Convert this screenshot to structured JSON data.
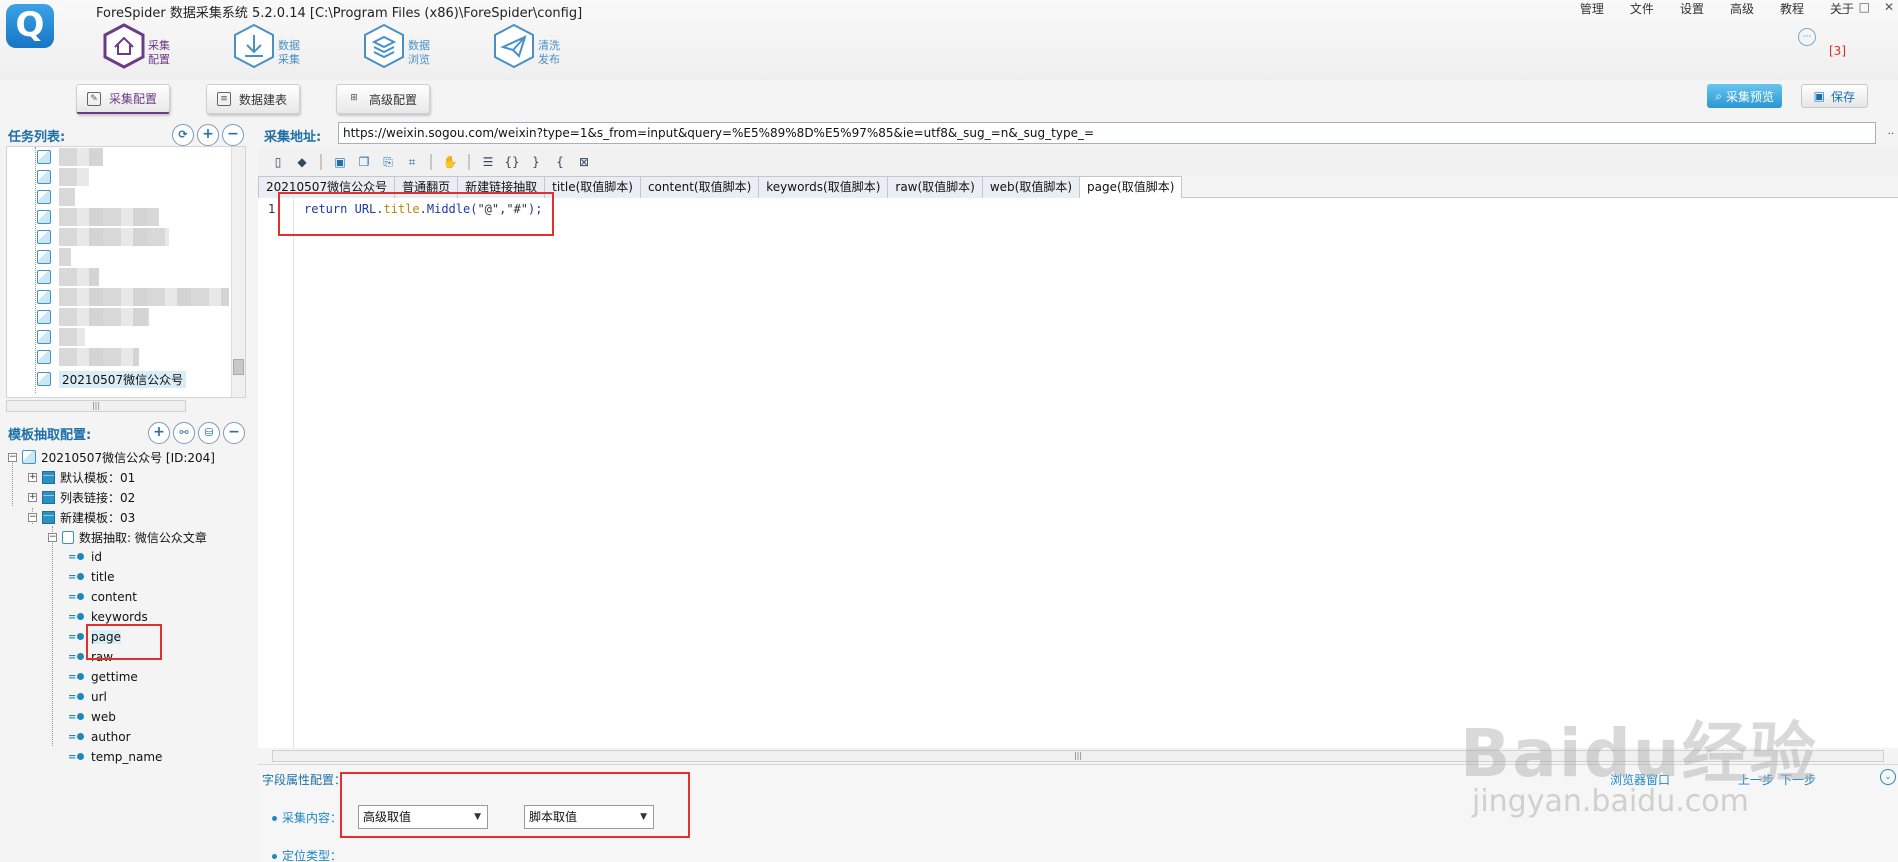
{
  "app": {
    "title": "ForeSpider 数据采集系统  5.2.0.14  [C:\\Program Files (x86)\\ForeSpider\\config]",
    "menu": [
      "管理",
      "文件",
      "设置",
      "高级",
      "教程",
      "关于"
    ],
    "window_controls": [
      "_",
      "□",
      "✕"
    ],
    "notification_count": "[3]"
  },
  "main_nav": [
    {
      "line1": "采集",
      "line2": "配置"
    },
    {
      "line1": "数据",
      "line2": "采集"
    },
    {
      "line1": "数据",
      "line2": "浏览"
    },
    {
      "line1": "清洗",
      "line2": "发布"
    }
  ],
  "sub_tabs": [
    "采集配置",
    "数据建表",
    "高级配置"
  ],
  "actions": {
    "preview": "采集预览",
    "save": "保存"
  },
  "task_list": {
    "title": "任务列表:",
    "visible_task": "20210507微信公众号"
  },
  "template_config": {
    "title": "模板抽取配置:",
    "root": "20210507微信公众号 [ID:204]",
    "templates": [
      "默认模板：01",
      "列表链接：02",
      "新建模板：03"
    ],
    "extraction": "数据抽取: 微信公众文章",
    "fields": [
      "id",
      "title",
      "content",
      "keywords",
      "page",
      "raw",
      "gettime",
      "url",
      "web",
      "author",
      "temp_name"
    ]
  },
  "url_bar": {
    "label": "采集地址:",
    "value": "https://weixin.sogou.com/weixin?type=1&s_from=input&query=%E5%89%8D%E5%97%85&ie=utf8&_sug_=n&_sug_type_=",
    "more": ".."
  },
  "code_tabs": [
    "20210507微信公众号",
    "普通翻页",
    "新建链接抽取",
    "title(取值脚本)",
    "content(取值脚本)",
    "keywords(取值脚本)",
    "raw(取值脚本)",
    "web(取值脚本)",
    "page(取值脚本)"
  ],
  "editor": {
    "line_number": "1",
    "code": {
      "kw": "return",
      "obj": "URL",
      "dot1": ".",
      "prop": "title",
      "dot2": ".",
      "method": "Middle(",
      "args": "\"@\",\"#\"",
      "end": ");"
    }
  },
  "field_props": {
    "title": "字段属性配置：",
    "browser_window": "浏览器窗口",
    "prev": "上一步",
    "next": "下一步",
    "content_label": "采集内容：",
    "content_value": "高级取值",
    "script_value": "脚本取值",
    "locate_label": "定位类型："
  },
  "watermark": {
    "brand": "Baidu经验",
    "url": "jingyan.baidu.com"
  }
}
